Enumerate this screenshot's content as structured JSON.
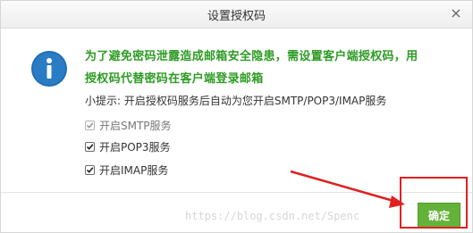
{
  "dialog": {
    "title": "设置授权码",
    "close_symbol": "×",
    "icon": "info-icon",
    "headline_line1": "为了避免密码泄露造成邮箱安全隐患，需设置客户端授权码，用",
    "headline_line2": "授权码代替密码在客户端登录邮箱",
    "tip": "小提示: 开启授权码服务后自动为您开启SMTP/POP3/IMAP服务",
    "options": [
      {
        "label": "开启SMTP服务",
        "checked": true,
        "disabled": true
      },
      {
        "label": "开启POP3服务",
        "checked": true,
        "disabled": false
      },
      {
        "label": "开启IMAP服务",
        "checked": true,
        "disabled": false
      }
    ],
    "confirm_label": "确定"
  },
  "annotation": {
    "color": "#e02020"
  },
  "watermark": "https://blog.csdn.net/Spenc",
  "colors": {
    "headline": "#2d9b23",
    "icon_blue": "#1f6fb5",
    "confirm_button": "#64b23a"
  }
}
